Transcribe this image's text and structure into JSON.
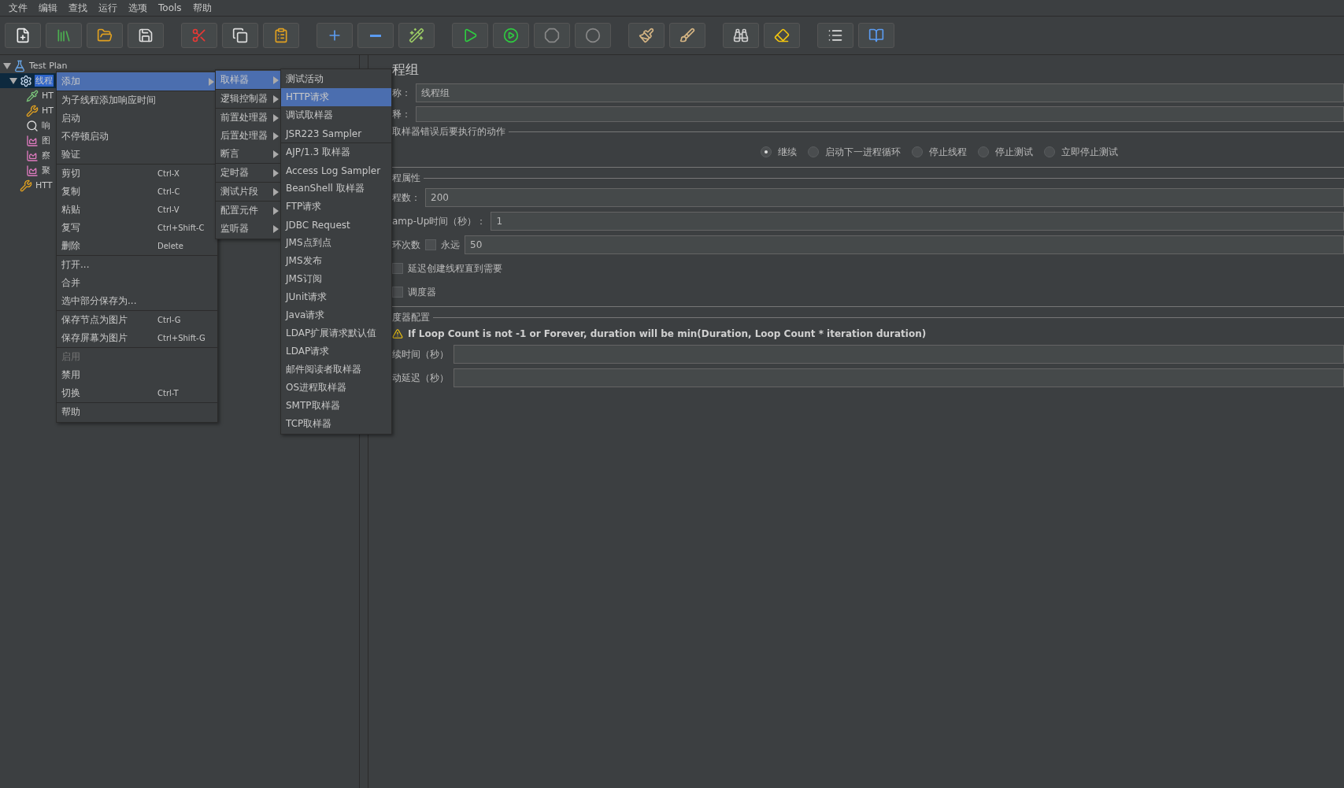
{
  "menu_bar": [
    {
      "label": "文件"
    },
    {
      "label": "编辑"
    },
    {
      "label": "查找"
    },
    {
      "label": "运行"
    },
    {
      "label": "选项"
    },
    {
      "label": "Tools"
    },
    {
      "label": "帮助"
    }
  ],
  "tree": [
    {
      "label": "Test Plan",
      "kind": "plan",
      "expanded": true,
      "selected": false,
      "children": [
        {
          "label": "线程",
          "kind": "threads",
          "expanded": true,
          "selected": true,
          "children": [
            {
              "label": "HT",
              "kind": "config",
              "selected": false
            },
            {
              "label": "HT",
              "kind": "tool",
              "selected": false
            },
            {
              "label": "响",
              "kind": "viewer",
              "selected": false
            },
            {
              "label": "图",
              "kind": "chart",
              "selected": false
            },
            {
              "label": "察",
              "kind": "chart",
              "selected": false
            },
            {
              "label": "聚",
              "kind": "chart",
              "selected": false
            }
          ]
        },
        {
          "label": "HTT",
          "kind": "tool",
          "selected": false
        }
      ]
    }
  ],
  "panel": {
    "title": "程组",
    "name_field": {
      "label": "称：",
      "value": "线程组"
    },
    "comment_field": {
      "label": "释："
    },
    "error_action": {
      "legend": "取样器错误后要执行的动作",
      "options": [
        {
          "label": "继续",
          "selected": true
        },
        {
          "label": "启动下一进程循环",
          "selected": false
        },
        {
          "label": "停止线程",
          "selected": false
        },
        {
          "label": "停止测试",
          "selected": false
        },
        {
          "label": "立即停止测试",
          "selected": false
        }
      ]
    },
    "thread_properties": {
      "legend": "程属性",
      "thread_count": {
        "label": "程数：",
        "value": "200"
      },
      "ramp_up": {
        "label": "amp-Up时间（秒）：",
        "value": "1"
      },
      "loop": {
        "label": "环次数",
        "forever": {
          "label": "永远",
          "checked": false
        },
        "value": "50"
      },
      "options": [
        {
          "label": "延迟创建线程直到需要",
          "checked": false
        },
        {
          "label": "调度器",
          "checked": false
        }
      ]
    },
    "scheduler": {
      "legend": "度器配置",
      "warning": "If Loop Count is not -1 or Forever, duration will be min(Duration, Loop Count * iteration duration)",
      "fields": [
        {
          "label": "续时间（秒）"
        },
        {
          "label": "动延迟（秒）"
        }
      ]
    }
  },
  "context_menus": [
    {
      "groups": [
        {
          "items": [
            {
              "label": "添加",
              "selected": true,
              "submenu": true,
              "disabled": false
            }
          ]
        },
        {
          "items": [
            {
              "label": "为子线程添加响应时间",
              "selected": false,
              "submenu": false,
              "disabled": false
            },
            {
              "label": "启动",
              "selected": false,
              "submenu": false,
              "disabled": false
            },
            {
              "label": "不停顿启动",
              "selected": false,
              "submenu": false,
              "disabled": false
            },
            {
              "label": "验证",
              "selected": false,
              "submenu": false,
              "disabled": false
            }
          ]
        },
        {
          "items": [
            {
              "label": "剪切",
              "shortcut": "Ctrl-X",
              "selected": false,
              "submenu": false,
              "disabled": false
            },
            {
              "label": "复制",
              "shortcut": "Ctrl-C",
              "selected": false,
              "submenu": false,
              "disabled": false
            },
            {
              "label": "粘贴",
              "shortcut": "Ctrl-V",
              "selected": false,
              "submenu": false,
              "disabled": false
            },
            {
              "label": "复写",
              "shortcut": "Ctrl+Shift-C",
              "selected": false,
              "submenu": false,
              "disabled": false
            },
            {
              "label": "删除",
              "shortcut": "Delete",
              "selected": false,
              "submenu": false,
              "disabled": false
            }
          ]
        },
        {
          "items": [
            {
              "label": "打开...",
              "selected": false,
              "submenu": false,
              "disabled": false
            },
            {
              "label": "合并",
              "selected": false,
              "submenu": false,
              "disabled": false
            },
            {
              "label": "选中部分保存为...",
              "selected": false,
              "submenu": false,
              "disabled": false
            }
          ]
        },
        {
          "items": [
            {
              "label": "保存节点为图片",
              "shortcut": "Ctrl-G",
              "selected": false,
              "submenu": false,
              "disabled": false
            },
            {
              "label": "保存屏幕为图片",
              "shortcut": "Ctrl+Shift-G",
              "selected": false,
              "submenu": false,
              "disabled": false
            }
          ]
        },
        {
          "items": [
            {
              "label": "启用",
              "selected": false,
              "submenu": false,
              "disabled": true
            },
            {
              "label": "禁用",
              "selected": false,
              "submenu": false,
              "disabled": false
            },
            {
              "label": "切换",
              "shortcut": "Ctrl-T",
              "selected": false,
              "submenu": false,
              "disabled": false
            }
          ]
        },
        {
          "items": [
            {
              "label": "帮助",
              "selected": false,
              "submenu": false,
              "disabled": false
            }
          ]
        }
      ]
    },
    {
      "groups": [
        {
          "items": [
            {
              "label": "取样器",
              "selected": true,
              "submenu": true
            }
          ]
        },
        {
          "items": [
            {
              "label": "逻辑控制器",
              "selected": false,
              "submenu": true
            }
          ]
        },
        {
          "items": [
            {
              "label": "前置处理器",
              "selected": false,
              "submenu": true
            },
            {
              "label": "后置处理器",
              "selected": false,
              "submenu": true
            },
            {
              "label": "断言",
              "selected": false,
              "submenu": true
            }
          ]
        },
        {
          "items": [
            {
              "label": "定时器",
              "selected": false,
              "submenu": true
            }
          ]
        },
        {
          "items": [
            {
              "label": "测试片段",
              "selected": false,
              "submenu": true
            }
          ]
        },
        {
          "items": [
            {
              "label": "配置元件",
              "selected": false,
              "submenu": true
            },
            {
              "label": "监听器",
              "selected": false,
              "submenu": true
            }
          ]
        }
      ]
    },
    {
      "groups": [
        {
          "items": [
            {
              "label": "测试活动",
              "selected": false
            },
            {
              "label": "HTTP请求",
              "selected": true
            },
            {
              "label": "调试取样器",
              "selected": false
            },
            {
              "label": "JSR223 Sampler",
              "selected": false
            }
          ]
        },
        {
          "items": [
            {
              "label": "AJP/1.3 取样器",
              "selected": false
            },
            {
              "label": "Access Log Sampler",
              "selected": false
            },
            {
              "label": "BeanShell 取样器",
              "selected": false
            },
            {
              "label": "FTP请求",
              "selected": false
            },
            {
              "label": "JDBC Request",
              "selected": false
            },
            {
              "label": "JMS点到点",
              "selected": false
            },
            {
              "label": "JMS发布",
              "selected": false
            },
            {
              "label": "JMS订阅",
              "selected": false
            },
            {
              "label": "JUnit请求",
              "selected": false
            },
            {
              "label": "Java请求",
              "selected": false
            },
            {
              "label": "LDAP扩展请求默认值",
              "selected": false
            },
            {
              "label": "LDAP请求",
              "selected": false
            },
            {
              "label": "邮件阅读者取样器",
              "selected": false
            },
            {
              "label": "OS进程取样器",
              "selected": false
            },
            {
              "label": "SMTP取样器",
              "selected": false
            },
            {
              "label": "TCP取样器",
              "selected": false
            }
          ]
        }
      ]
    }
  ]
}
